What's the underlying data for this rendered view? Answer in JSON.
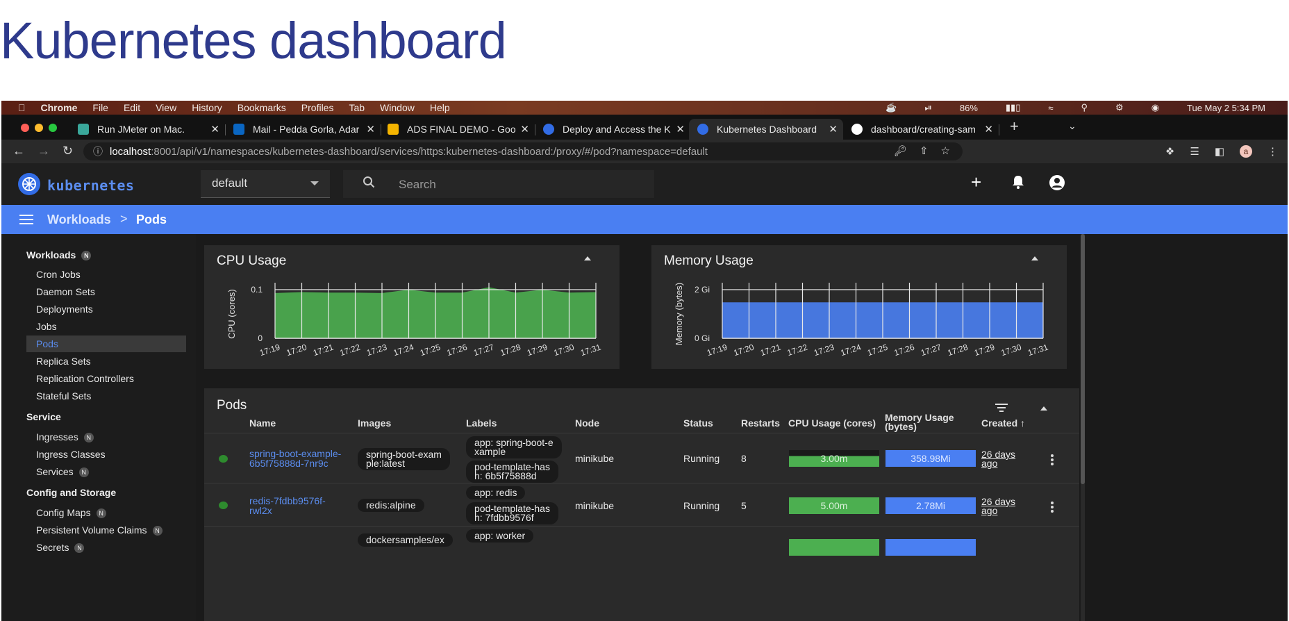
{
  "slide": {
    "title": "Kubernetes dashboard"
  },
  "macbar": {
    "menus": [
      "Chrome",
      "File",
      "Edit",
      "View",
      "History",
      "Bookmarks",
      "Profiles",
      "Tab",
      "Window",
      "Help"
    ],
    "battery": "86%",
    "datetime": "Tue May 2  5:34 PM"
  },
  "tabs": [
    {
      "label": "Run JMeter on Mac.",
      "color": "#3aa79a"
    },
    {
      "label": "Mail - Pedda Gorla, Adar",
      "color": "#0a66c2"
    },
    {
      "label": "ADS FINAL DEMO - Goo",
      "color": "#f4b400"
    },
    {
      "label": "Deploy and Access the K",
      "color": "#326ce5"
    },
    {
      "label": "Kubernetes Dashboard",
      "color": "#326ce5"
    },
    {
      "label": "dashboard/creating-sam",
      "color": "#ffffff"
    }
  ],
  "address": {
    "host": "localhost",
    "path": ":8001/api/v1/namespaces/kubernetes-dashboard/services/https:kubernetes-dashboard:/proxy/#/pod?namespace=default",
    "profile_initial": "a"
  },
  "header": {
    "brand": "kubernetes",
    "namespace": "default",
    "search_placeholder": "Search"
  },
  "breadcrumb": {
    "parent": "Workloads",
    "sep": ">",
    "current": "Pods"
  },
  "sidebar": {
    "workloads": {
      "label": "Workloads",
      "badge": "N"
    },
    "workload_items": [
      "Cron Jobs",
      "Daemon Sets",
      "Deployments",
      "Jobs",
      "Pods",
      "Replica Sets",
      "Replication Controllers",
      "Stateful Sets"
    ],
    "service": {
      "label": "Service"
    },
    "service_items": [
      {
        "label": "Ingresses",
        "badge": "N"
      },
      {
        "label": "Ingress Classes",
        "badge": ""
      },
      {
        "label": "Services",
        "badge": "N"
      }
    ],
    "config": {
      "label": "Config and Storage"
    },
    "config_items": [
      {
        "label": "Config Maps",
        "badge": "N"
      },
      {
        "label": "Persistent Volume Claims",
        "badge": "N"
      },
      {
        "label": "Secrets",
        "badge": "N"
      }
    ]
  },
  "cpu_card": {
    "title": "CPU Usage"
  },
  "memory_card": {
    "title": "Memory Usage"
  },
  "chart_data": [
    {
      "type": "area",
      "title": "CPU Usage",
      "ylabel": "CPU (cores)",
      "y_ticks": [
        "0",
        "0.1"
      ],
      "ylim": [
        0,
        0.1
      ],
      "x": [
        "17:19",
        "17:20",
        "17:21",
        "17:22",
        "17:23",
        "17:24",
        "17:25",
        "17:26",
        "17:27",
        "17:28",
        "17:29",
        "17:30",
        "17:31"
      ],
      "values": [
        0.093,
        0.095,
        0.094,
        0.094,
        0.093,
        0.1,
        0.094,
        0.094,
        0.105,
        0.094,
        0.1,
        0.094,
        0.095
      ],
      "color": "#4caf50"
    },
    {
      "type": "area",
      "title": "Memory Usage",
      "ylabel": "Memory (bytes)",
      "y_ticks": [
        "0 Gi",
        "2 Gi"
      ],
      "ylim": [
        0,
        2
      ],
      "x": [
        "17:19",
        "17:20",
        "17:21",
        "17:22",
        "17:23",
        "17:24",
        "17:25",
        "17:26",
        "17:27",
        "17:28",
        "17:29",
        "17:30",
        "17:31"
      ],
      "values": [
        1.48,
        1.48,
        1.48,
        1.48,
        1.48,
        1.48,
        1.48,
        1.48,
        1.48,
        1.48,
        1.48,
        1.48,
        1.48
      ],
      "color": "#4a7ff2"
    }
  ],
  "pods_card": {
    "title": "Pods",
    "columns": [
      "Name",
      "Images",
      "Labels",
      "Node",
      "Status",
      "Restarts",
      "CPU Usage (cores)",
      "Memory Usage (bytes)",
      "Created"
    ],
    "rows": [
      {
        "name_l1": "spring-boot-example-",
        "name_l2": "6b5f75888d-7nr9c",
        "image_l1": "spring-boot-exam",
        "image_l2": "ple:latest",
        "label1_l1": "app: spring-boot-e",
        "label1_l2": "xample",
        "label2_l1": "pod-template-has",
        "label2_l2": "h: 6b5f75888d",
        "node": "minikube",
        "status": "Running",
        "restarts": "8",
        "cpu": "3.00m",
        "memory": "358.98Mi",
        "created_l1": "26 days",
        "created_l2": "ago"
      },
      {
        "name_l1": "redis-7fdbb9576f-",
        "name_l2": "rwl2x",
        "image_l1": "redis:alpine",
        "label1_l1": "app: redis",
        "label2_l1": "pod-template-has",
        "label2_l2": "h: 7fdbb9576f",
        "node": "minikube",
        "status": "Running",
        "restarts": "5",
        "cpu": "5.00m",
        "memory": "2.78Mi",
        "created_l1": "26 days",
        "created_l2": "ago"
      },
      {
        "image_l1": "dockersamples/ex",
        "label1_l1": "app: worker"
      }
    ]
  }
}
